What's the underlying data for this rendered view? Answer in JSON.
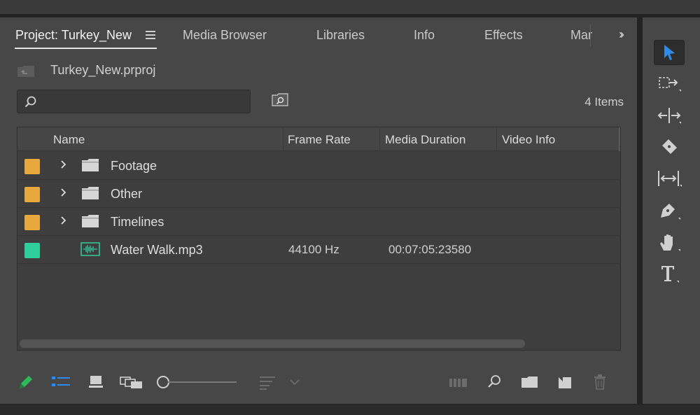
{
  "tabs": [
    {
      "label": "Project: Turkey_New",
      "active": true
    },
    {
      "label": "Media Browser"
    },
    {
      "label": "Libraries"
    },
    {
      "label": "Info"
    },
    {
      "label": "Effects"
    },
    {
      "label": "Mar"
    }
  ],
  "project": {
    "file_name": "Turkey_New.prproj",
    "search_value": "",
    "item_count": "4 Items"
  },
  "table": {
    "columns": [
      "Name",
      "Frame Rate",
      "Media Duration",
      "Video Info"
    ],
    "rows": [
      {
        "name": "Footage",
        "kind": "folder-icon",
        "label_color": "#e8a83e",
        "frame_rate": "",
        "duration": ""
      },
      {
        "name": "Other",
        "kind": "folder-icon",
        "label_color": "#e8a83e",
        "frame_rate": "",
        "duration": ""
      },
      {
        "name": "Timelines",
        "kind": "folder-icon",
        "label_color": "#e8a83e",
        "frame_rate": "",
        "duration": ""
      },
      {
        "name": "Water Walk.mp3",
        "kind": "audio-file-icon",
        "label_color": "#2ecf9a",
        "frame_rate": "44100 Hz",
        "duration": "00:07:05:23580"
      }
    ]
  },
  "colors": {
    "folder_label": "#e8a83e",
    "audio_label": "#2ecf9a",
    "accent_blue": "#2d8ceb",
    "pencil_green": "#2dbb5a"
  },
  "tools": [
    "selection-tool-icon",
    "track-select-forward-tool-icon",
    "ripple-edit-tool-icon",
    "razor-tool-icon",
    "slip-tool-icon",
    "pen-tool-icon",
    "hand-tool-icon",
    "type-tool-icon"
  ]
}
